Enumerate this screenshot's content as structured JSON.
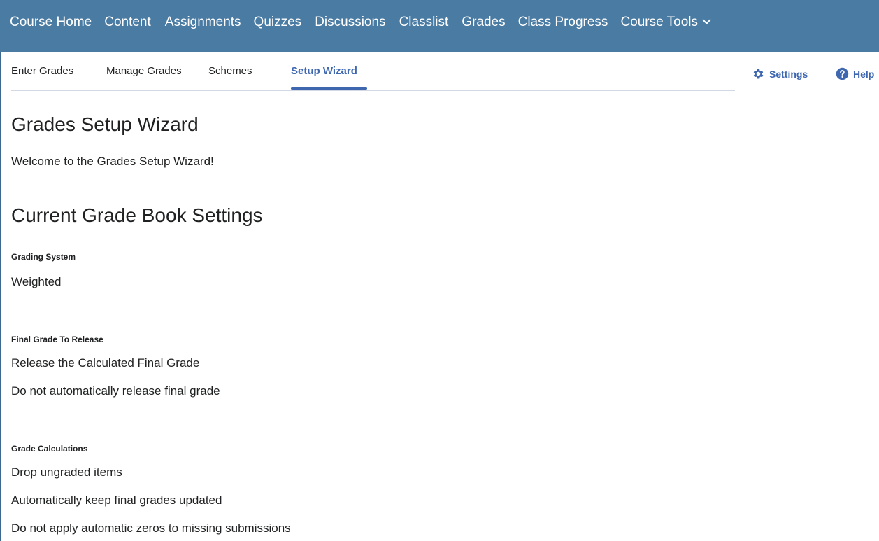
{
  "navbar": {
    "items": [
      "Course Home",
      "Content",
      "Assignments",
      "Quizzes",
      "Discussions",
      "Classlist",
      "Grades",
      "Class Progress",
      "Course Tools"
    ]
  },
  "subnav": {
    "tabs": [
      "Enter Grades",
      "Manage Grades",
      "Schemes",
      "Setup Wizard"
    ],
    "active_tab": "Setup Wizard",
    "settings_label": "Settings",
    "help_label": "Help"
  },
  "page": {
    "title": "Grades Setup Wizard",
    "welcome": "Welcome to the Grades Setup Wizard!",
    "section_title": "Current Grade Book Settings"
  },
  "settings": {
    "grading_system": {
      "label": "Grading System",
      "values": [
        "Weighted"
      ]
    },
    "final_grade": {
      "label": "Final Grade To Release",
      "values": [
        "Release the Calculated Final Grade",
        "Do not automatically release final grade"
      ]
    },
    "grade_calculations": {
      "label": "Grade Calculations",
      "values": [
        "Drop ungraded items",
        "Automatically keep final grades updated",
        "Do not apply automatic zeros to missing submissions"
      ]
    }
  },
  "colors": {
    "navbar": "#4a7ba3",
    "accent": "#3e67b0"
  },
  "icons": {
    "settings": "gear-icon",
    "help": "help-circle-icon",
    "course_tools": "chevron-down-icon"
  }
}
